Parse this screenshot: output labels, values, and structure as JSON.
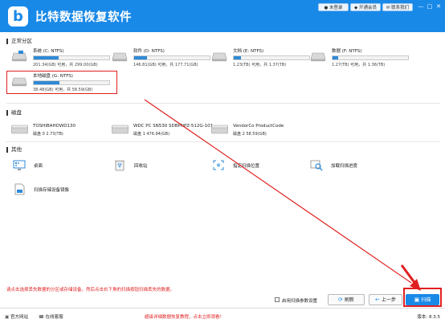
{
  "app": {
    "title": "比特数据恢复软件",
    "logo_letter": "b",
    "colors": {
      "accent": "#1989e8",
      "highlight": "#e02020"
    }
  },
  "titlebar": {
    "buttons": [
      {
        "label": "未登录",
        "icon": "user-icon"
      },
      {
        "label": "开通会员",
        "icon": "vip-icon"
      },
      {
        "label": "联系我们",
        "icon": "contact-icon"
      }
    ],
    "window_controls": [
      "—",
      "□",
      "✕"
    ]
  },
  "sections": {
    "partitions": "正常分区",
    "disks": "磁盘",
    "other": "其他"
  },
  "partitions": [
    {
      "name": "系统 (C: NTFS)",
      "info": "201.34(GB) 可用，共 299.00(GB)",
      "used_fraction": 0.33
    },
    {
      "name": "软件 (D: NTFS)",
      "info": "146.81(GB) 可用，共 177.71(GB)",
      "used_fraction": 0.17
    },
    {
      "name": "文档 (E: NTFS)",
      "info": "1.23(TB) 可用，共 1.37(TB)",
      "used_fraction": 0.1
    },
    {
      "name": "数据 (F: NTFS)",
      "info": "1.27(TB) 可用，共 1.36(TB)",
      "used_fraction": 0.07
    },
    {
      "name": "本地磁盘 (G: NTFS)",
      "info": "38.48(GB) 可用，共 58.59(GB)",
      "used_fraction": 0.34
    }
  ],
  "disks": [
    {
      "name": "TOSHIBAHDWD130",
      "info": "磁盘 0    2.73(TB)"
    },
    {
      "name": "WDC PC SN530 SDBPNPZ-512G-1014",
      "info": "磁盘 1    476.94(GB)"
    },
    {
      "name": "VendorCo ProductCode",
      "info": "磁盘 2    58.59(GB)"
    }
  ],
  "other_items": [
    {
      "label": "桌面",
      "icon": "desktop-icon"
    },
    {
      "label": "回收站",
      "icon": "recycle-bin-icon"
    },
    {
      "label": "指定扫描位置",
      "icon": "location-icon"
    },
    {
      "label": "加载扫描进度",
      "icon": "load-progress-icon"
    },
    {
      "label": "扫描存储设备镜像",
      "icon": "disk-image-icon"
    }
  ],
  "bottom": {
    "instruction": "请点击选择丢失数据的分区或存储设备，然后点击右下角的扫描按钮扫描丢失的数据。",
    "checkbox_label": "启用扫描参数设置",
    "refresh_label": "刷新",
    "back_label": "上一步",
    "scan_label": "扫描"
  },
  "footer": {
    "website": "官方网站",
    "support": "在线客服",
    "tutorial": "超级详细数据恢复教程，点击立即观看！",
    "version": "版本: 8.3.5"
  }
}
